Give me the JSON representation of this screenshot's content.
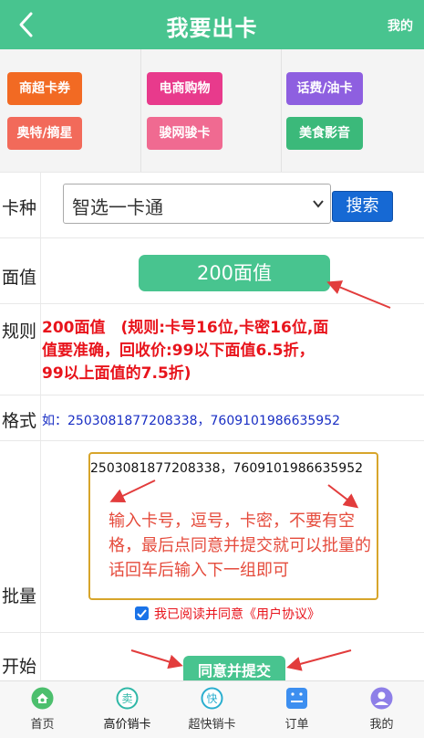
{
  "header": {
    "title": "我要出卡",
    "right_link": "我的"
  },
  "categories": [
    {
      "label": "商超卡券",
      "color": "#f26a23"
    },
    {
      "label": "电商购物",
      "color": "#e83a8c"
    },
    {
      "label": "话费/油卡",
      "color": "#8e5fe0"
    },
    {
      "label": "奥特/摘星",
      "color": "#f26a5a"
    },
    {
      "label": "骏网骏卡",
      "color": "#f06a91"
    },
    {
      "label": "美食影音",
      "color": "#3bb97a"
    }
  ],
  "form": {
    "card_type_label": "卡种",
    "card_type_value": "智选一卡通",
    "search_label": "搜索",
    "value_label": "面值",
    "value_selected": "200面值",
    "rule_label": "规则",
    "rule_text": "200面值　(规则:卡号16位,卡密16位,面值要准确，回收价:99以下面值6.5折，99以上面值的7.5折)",
    "format_label": "格式",
    "format_text": "如：2503081877208338，7609101986635952",
    "batch_label": "批量",
    "batch_value": "2503081877208338，7609101986635952",
    "batch_hint": "输入卡号，逗号，卡密，不要有空格，最后点同意并提交就可以批量的话回车后输入下一组即可",
    "agree_text": "我已阅读并同意《用户协议》",
    "agree_checked": true,
    "start_label": "开始",
    "submit_label": "同意并提交"
  },
  "tabbar": [
    {
      "label": "首页",
      "icon": "home-icon",
      "color": "#4cbf6d"
    },
    {
      "label": "高价销卡",
      "icon": "sell-icon",
      "color": "#2eb7a6"
    },
    {
      "label": "超快销卡",
      "icon": "fast-icon",
      "color": "#2aaecf"
    },
    {
      "label": "订单",
      "icon": "order-icon",
      "color": "#3d8ff0"
    },
    {
      "label": "我的",
      "icon": "user-icon",
      "color": "#8e7fe8"
    }
  ]
}
